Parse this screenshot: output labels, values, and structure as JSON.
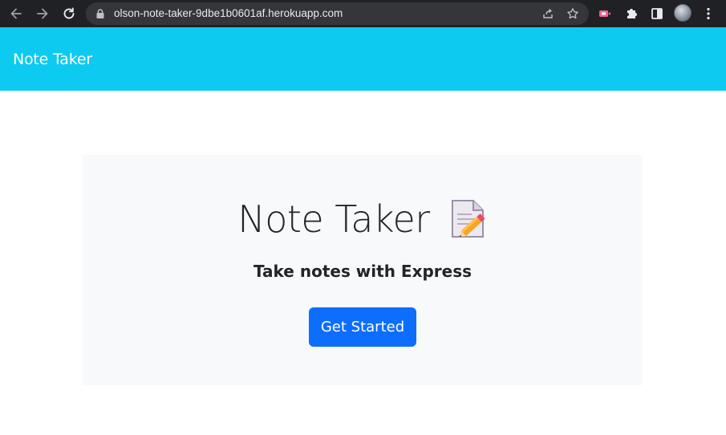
{
  "browser": {
    "url": "olson-note-taker-9dbe1b0601af.herokuapp.com",
    "icons": [
      "back-arrow-icon",
      "forward-arrow-icon",
      "reload-icon",
      "lock-icon",
      "share-icon",
      "star-icon",
      "extension-icon",
      "puzzle-icon",
      "side-panel-icon",
      "avatar",
      "kebab-menu-icon"
    ]
  },
  "navbar": {
    "brand": "Note Taker",
    "color": "#0dcaf0"
  },
  "hero": {
    "title": "Note Taker",
    "title_icon": "memo-pencil-icon",
    "subtitle": "Take notes with Express",
    "button_label": "Get Started",
    "button_color": "#0d6efd",
    "background": "#f8f9fa"
  }
}
